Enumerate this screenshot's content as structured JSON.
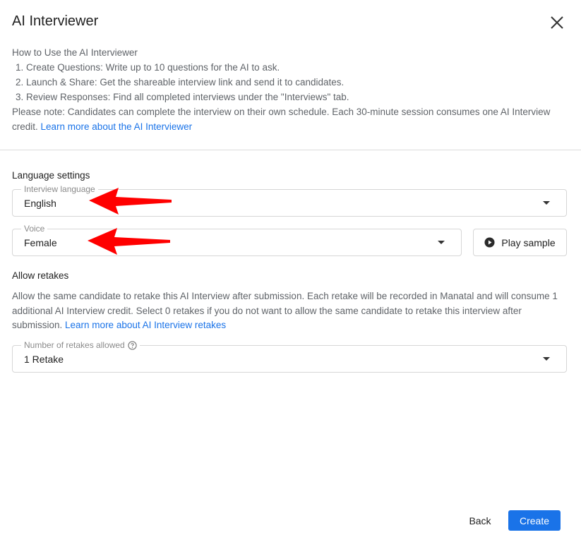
{
  "dialog": {
    "title": "AI Interviewer"
  },
  "intro": {
    "heading": "How to Use the AI Interviewer",
    "steps": [
      "1. Create Questions: Write up to 10 questions for the AI to ask.",
      "2. Launch & Share: Get the shareable interview link and send it to candidates.",
      "3. Review Responses: Find all completed interviews under the \"Interviews\" tab."
    ],
    "note": "Please note: Candidates can complete the interview on their own schedule. Each 30-minute session consumes one AI Interview credit.",
    "link": "Learn more about the AI Interviewer"
  },
  "language_settings": {
    "label": "Language settings",
    "interview_language": {
      "label": "Interview language",
      "value": "English"
    },
    "voice": {
      "label": "Voice",
      "value": "Female"
    },
    "play_sample_label": "Play sample"
  },
  "retakes": {
    "label": "Allow retakes",
    "description": "Allow the same candidate to retake this AI Interview after submission. Each retake will be recorded in Manatal and will consume 1 additional AI Interview credit. Select 0 retakes if you do not want to allow the same candidate to retake this interview after submission.",
    "link": "Learn more about AI Interview retakes",
    "number": {
      "label": "Number of retakes allowed",
      "value": "1 Retake"
    }
  },
  "footer": {
    "back_label": "Back",
    "create_label": "Create"
  },
  "colors": {
    "primary": "#1a73e8",
    "annotation_arrow": "#ff0000"
  },
  "icons": {
    "close": "close-icon",
    "caret": "caret-down-icon",
    "play": "play-circle-icon",
    "help": "help-circle-icon"
  }
}
